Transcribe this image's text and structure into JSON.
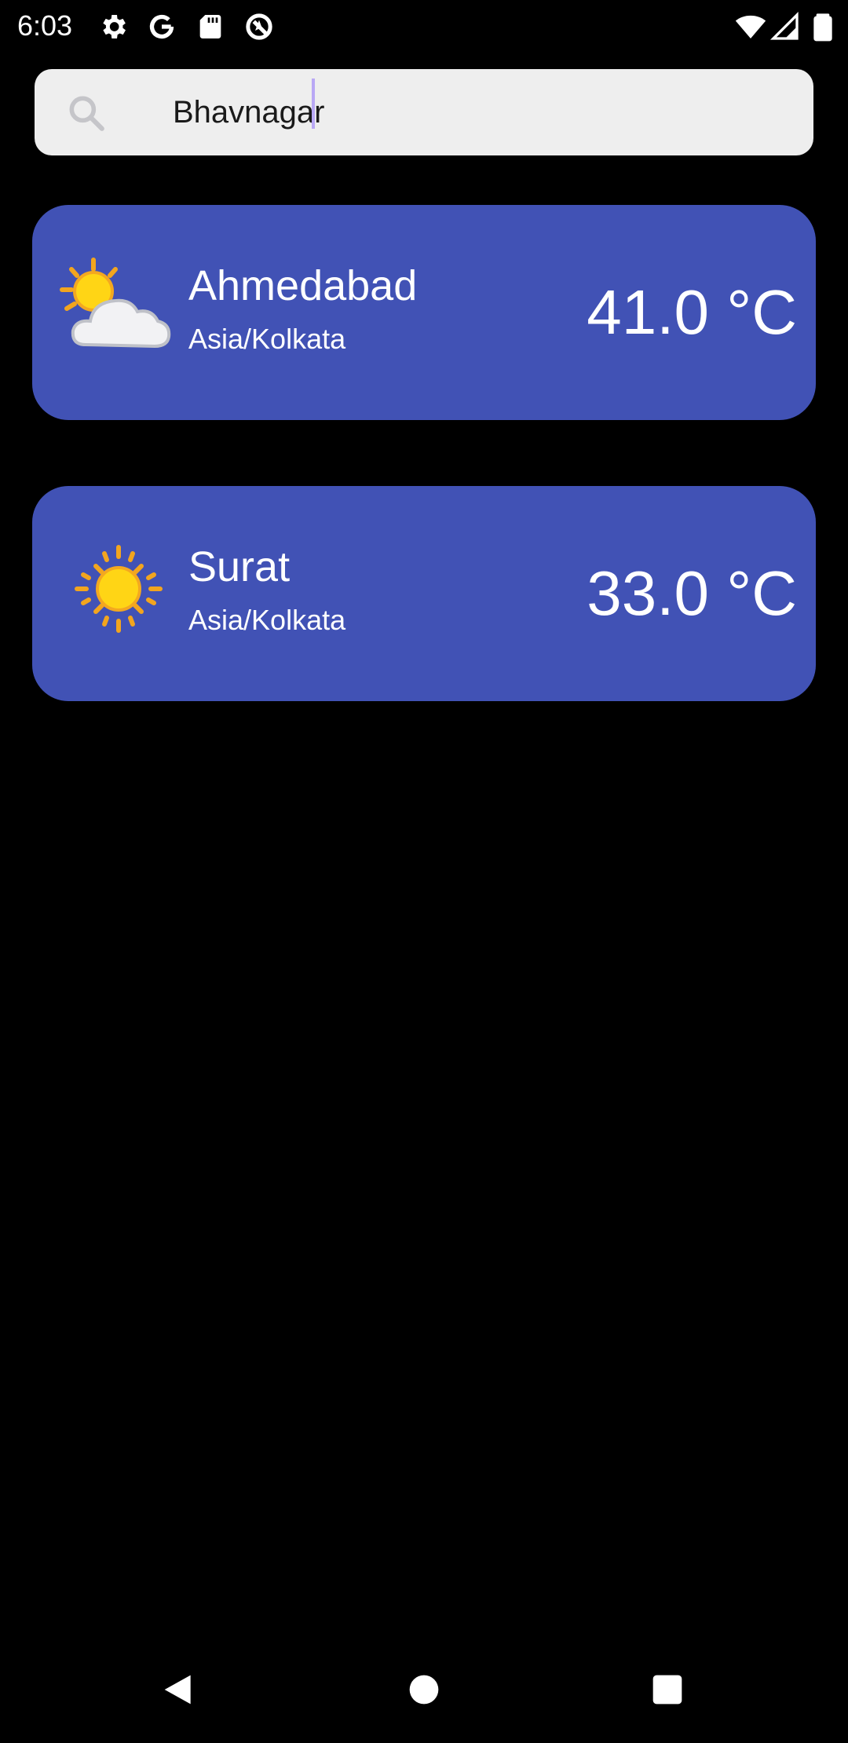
{
  "status_bar": {
    "time": "6:03",
    "left_icons": [
      "gear-icon",
      "google-icon",
      "sd-card-icon",
      "no-location-icon"
    ],
    "right_icons": [
      "wifi-icon",
      "cell-signal-icon",
      "battery-icon"
    ]
  },
  "search": {
    "value": "Bhavnagar",
    "icon": "search-icon"
  },
  "cards": [
    {
      "city": "Ahmedabad",
      "timezone": "Asia/Kolkata",
      "temperature": "41.0 °C",
      "icon": "partly-cloudy-icon"
    },
    {
      "city": "Surat",
      "timezone": "Asia/Kolkata",
      "temperature": "33.0 °C",
      "icon": "sunny-icon"
    }
  ],
  "nav_bar": {
    "buttons": [
      "back-icon",
      "home-icon",
      "recents-icon"
    ]
  },
  "colors": {
    "background": "#000000",
    "card": "#4152b5",
    "search_bg": "#eeeeee",
    "caret": "#b9a8f5"
  }
}
